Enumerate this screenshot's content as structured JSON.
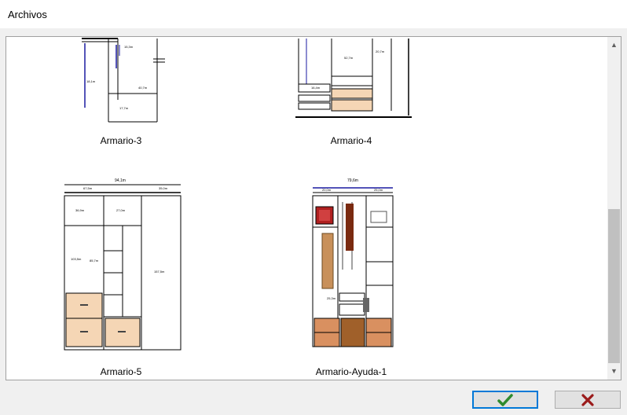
{
  "window": {
    "title": "Archivos"
  },
  "items": [
    {
      "label": "Armario-3"
    },
    {
      "label": "Armario-4"
    },
    {
      "label": "Armario-5"
    },
    {
      "label": "Armario-Ayuda-1"
    }
  ],
  "buttons": {
    "ok_icon": "check-icon",
    "cancel_icon": "close-icon",
    "ok_color": "#2e8b2e",
    "cancel_color": "#9b1b1b"
  }
}
